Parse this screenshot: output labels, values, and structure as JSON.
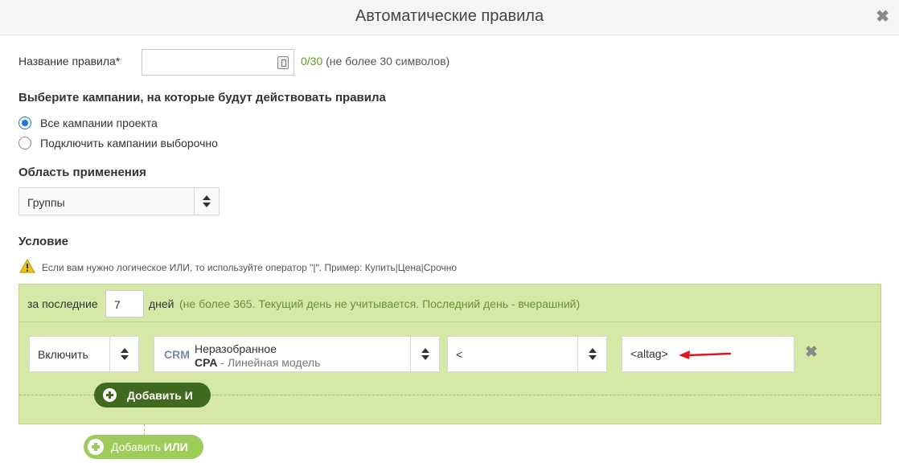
{
  "modal": {
    "title": "Автоматические правила",
    "close_icon": "close-icon"
  },
  "rule_name": {
    "label": "Название правила*",
    "value": "",
    "counter": "0/30",
    "counter_note": "(не более 30 символов)"
  },
  "campaigns": {
    "heading": "Выберите кампании, на которые будут действовать правила",
    "options": [
      {
        "label": "Все кампании проекта",
        "checked": true
      },
      {
        "label": "Подключить кампании выборочно",
        "checked": false
      }
    ]
  },
  "scope": {
    "heading": "Область применения",
    "selected": "Группы"
  },
  "condition": {
    "heading": "Условие",
    "hint": "Если вам нужно логическое ИЛИ, то используйте оператор \"|\". Пример: Купить|Цена|Срочно",
    "period_prefix": "за последние",
    "days": "7",
    "period_suffix": "дней",
    "period_note": "(не более 365. Текущий день не учитывается. Последний день - вчерашний)",
    "row": {
      "action": "Включить",
      "metric_badge": "CRM",
      "metric_name": "Неразобранное",
      "metric_sub_bold": "CPA",
      "metric_sub_rest": " - Линейная модель",
      "operator": "<",
      "value": "<altag>"
    },
    "add_and_label": "Добавить И",
    "add_or_prefix": "Добавить ",
    "add_or_bold": "ИЛИ"
  },
  "colors": {
    "panel_bg": "#d5e8a6",
    "add_and_bg": "#3f6a1f",
    "add_or_bg": "#9dcc58",
    "counter_green": "#5aa01a",
    "annotation_arrow": "#e0161e"
  }
}
